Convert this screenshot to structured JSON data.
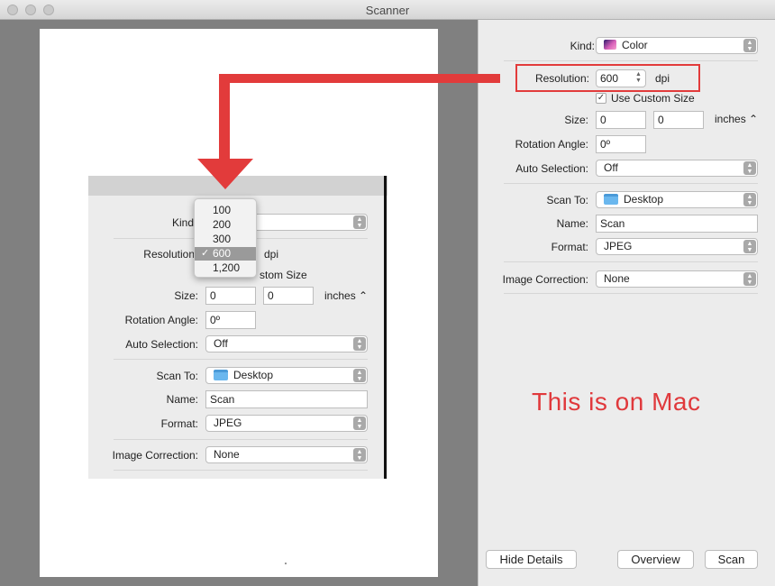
{
  "window": {
    "title": "Scanner"
  },
  "details": {
    "kind_label": "Kind:",
    "kind_value": "Color",
    "resolution_label": "Resolution:",
    "resolution_value": "600",
    "resolution_unit": "dpi",
    "custom_size_label": "Use Custom Size",
    "custom_size_checked": true,
    "size_label": "Size:",
    "size_width": "0",
    "size_height": "0",
    "size_unit": "inches",
    "rotation_label": "Rotation Angle:",
    "rotation_value": "0º",
    "auto_selection_label": "Auto Selection:",
    "auto_selection_value": "Off",
    "scan_to_label": "Scan To:",
    "scan_to_value": "Desktop",
    "name_label": "Name:",
    "name_value": "Scan",
    "format_label": "Format:",
    "format_value": "JPEG",
    "image_correction_label": "Image Correction:",
    "image_correction_value": "None"
  },
  "buttons": {
    "hide_details": "Hide Details",
    "overview": "Overview",
    "scan": "Scan"
  },
  "annotation": {
    "text": "This is on Mac",
    "color": "#e0393c"
  },
  "inset": {
    "kind_label": "Kind",
    "resolution_label": "Resolution",
    "resolution_unit": "dpi",
    "custom_size_partial": "stom Size",
    "size_label": "Size:",
    "size_width": "0",
    "size_height": "0",
    "size_unit": "inches",
    "rotation_label": "Rotation Angle:",
    "rotation_value": "0º",
    "auto_selection_label": "Auto Selection:",
    "auto_selection_value": "Off",
    "scan_to_label": "Scan To:",
    "scan_to_value": "Desktop",
    "name_label": "Name:",
    "name_value": "Scan",
    "format_label": "Format:",
    "format_value": "JPEG",
    "image_correction_label": "Image Correction:",
    "image_correction_value": "None",
    "resolution_options": [
      "100",
      "200",
      "300",
      "600",
      "1,200"
    ],
    "selected_option": "600"
  }
}
